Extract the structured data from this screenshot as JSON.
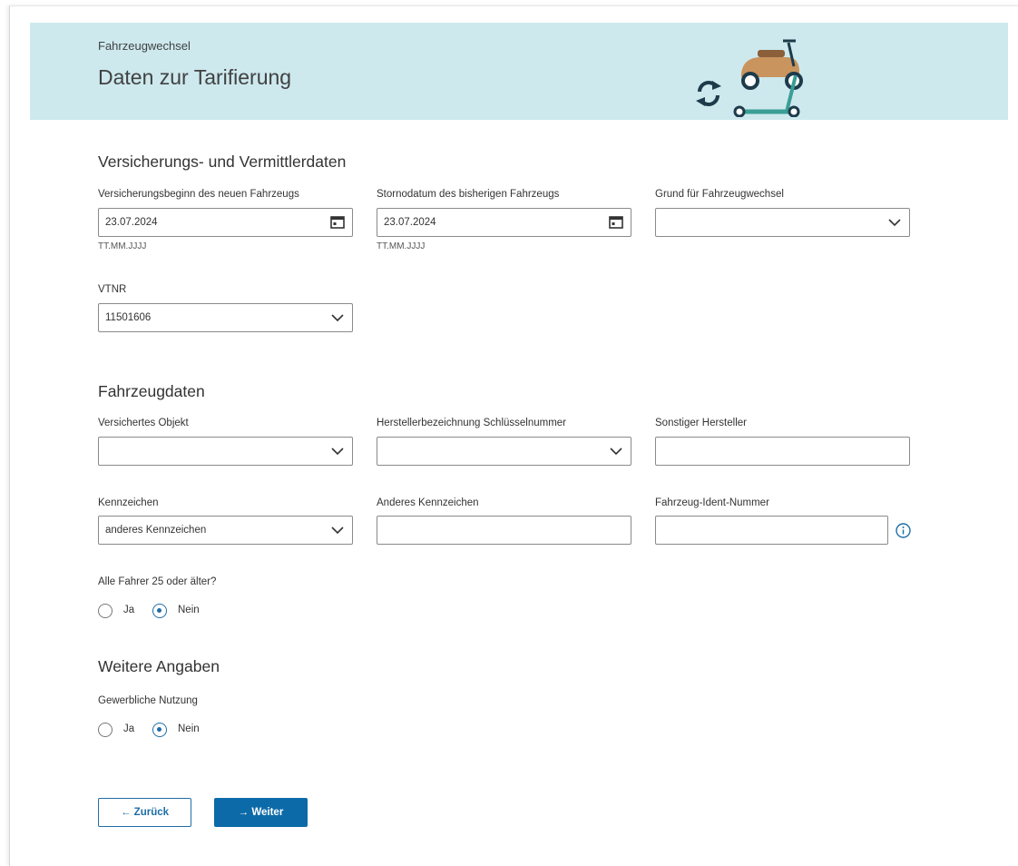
{
  "header": {
    "breadcrumb": "Fahrzeugwechsel",
    "title": "Daten zur Tarifierung"
  },
  "sections": {
    "insurance": "Versicherungs- und Vermittlerdaten",
    "vehicle": "Fahrzeugdaten",
    "more": "Weitere Angaben"
  },
  "insurance": {
    "start_label": "Versicherungsbeginn des neuen Fahrzeugs",
    "start_value": "23.07.2024",
    "start_hint": "TT.MM.JJJJ",
    "cancel_label": "Stornodatum des bisherigen Fahrzeugs",
    "cancel_value": "23.07.2024",
    "cancel_hint": "TT.MM.JJJJ",
    "reason_label": "Grund für Fahrzeugwechsel",
    "reason_value": "",
    "vtnr_label": "VTNR",
    "vtnr_value": "11501606"
  },
  "vehicle": {
    "object_label": "Versichertes Objekt",
    "object_value": "",
    "maker_label": "Herstellerbezeichnung Schlüsselnummer",
    "maker_value": "",
    "other_maker_label": "Sonstiger Hersteller",
    "other_maker_value": "",
    "plate_label": "Kennzeichen",
    "plate_value": "anderes Kennzeichen",
    "other_plate_label": "Anderes Kennzeichen",
    "other_plate_value": "",
    "vin_label": "Fahrzeug-Ident-Nummer",
    "vin_value": "",
    "drivers_label": "Alle Fahrer 25 oder älter?",
    "yes": "Ja",
    "no": "Nein",
    "drivers_selected": "Nein"
  },
  "more": {
    "commercial_label": "Gewerbliche Nutzung",
    "yes": "Ja",
    "no": "Nein",
    "commercial_selected": "Nein"
  },
  "buttons": {
    "back": "← Zurück",
    "next": "→ Weiter"
  },
  "colors": {
    "header_bg": "#cde9ee",
    "accent": "#0d6aa8"
  },
  "icons": {
    "calendar": "calendar-icon",
    "chevron": "chevron-down-icon",
    "info": "info-icon",
    "illustration": "vehicle-swap-illustration"
  }
}
